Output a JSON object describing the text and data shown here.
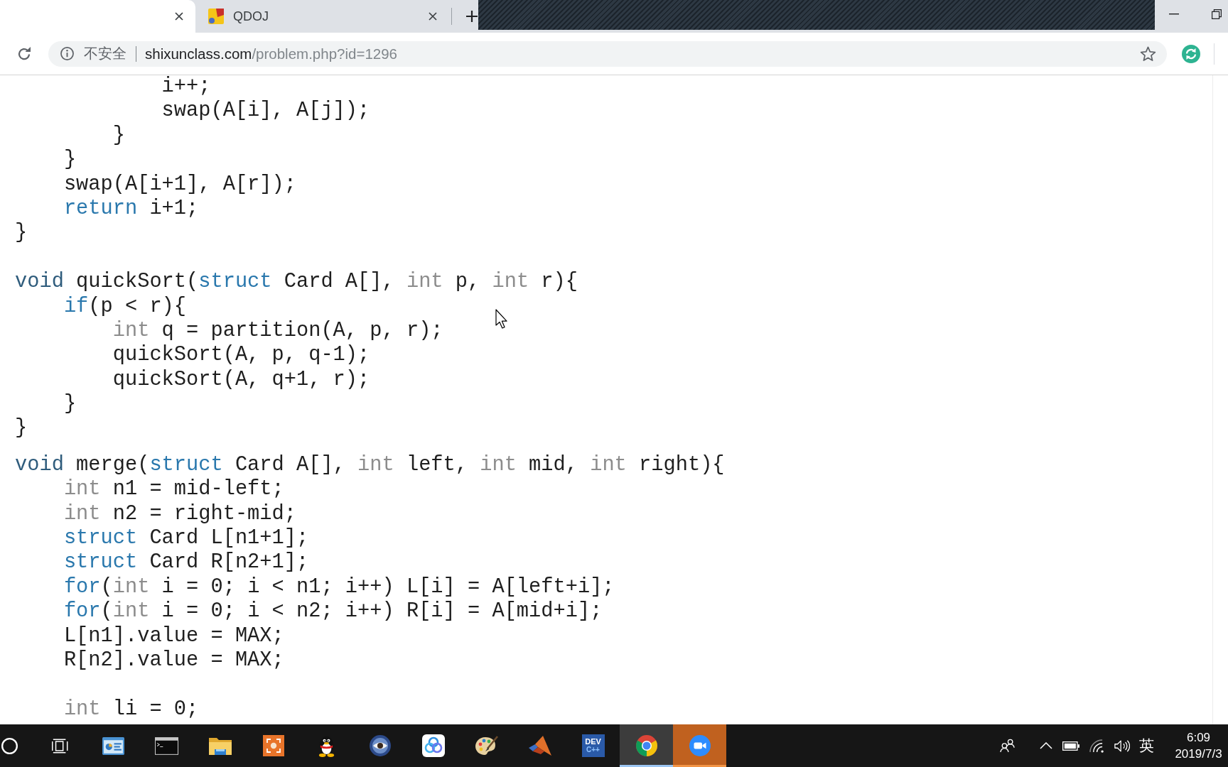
{
  "browser": {
    "tabs": [
      {
        "selected": true
      },
      {
        "title": "QDOJ",
        "selected": false
      }
    ],
    "toolbar": {
      "security_label": "不安全",
      "url_host": "shixunclass.com",
      "url_path": "/problem.php?id=1296"
    }
  },
  "page": {
    "code_blocks": [
      {
        "lines": [
          {
            "kind": "code",
            "tokens": [
              {
                "kind": "plain",
                "text": "            i++;"
              }
            ]
          },
          {
            "kind": "code",
            "tokens": [
              {
                "kind": "plain",
                "text": "            swap(A[i], A[j]);"
              }
            ]
          },
          {
            "kind": "code",
            "tokens": [
              {
                "kind": "plain",
                "text": "        }"
              }
            ]
          },
          {
            "kind": "code",
            "tokens": [
              {
                "kind": "plain",
                "text": "    }"
              }
            ]
          },
          {
            "kind": "code",
            "tokens": [
              {
                "kind": "plain",
                "text": "    swap(A[i+1], A[r]);"
              }
            ]
          },
          {
            "kind": "code",
            "tokens": [
              {
                "kind": "keyword",
                "text": "    return"
              },
              {
                "kind": "plain",
                "text": " i+1;"
              }
            ]
          },
          {
            "kind": "code",
            "tokens": [
              {
                "kind": "plain",
                "text": "}"
              }
            ]
          },
          {
            "kind": "blank"
          },
          {
            "kind": "code",
            "tokens": [
              {
                "kind": "keyword_dark",
                "text": "void"
              },
              {
                "kind": "plain",
                "text": " quickSort("
              },
              {
                "kind": "keyword",
                "text": "struct"
              },
              {
                "kind": "plain",
                "text": " Card A[], "
              },
              {
                "kind": "type",
                "text": "int"
              },
              {
                "kind": "plain",
                "text": " p, "
              },
              {
                "kind": "type",
                "text": "int"
              },
              {
                "kind": "plain",
                "text": " r){"
              }
            ]
          },
          {
            "kind": "code",
            "tokens": [
              {
                "kind": "keyword",
                "text": "    if"
              },
              {
                "kind": "plain",
                "text": "(p < r){"
              }
            ]
          },
          {
            "kind": "code",
            "tokens": [
              {
                "kind": "type",
                "text": "        int"
              },
              {
                "kind": "plain",
                "text": " q = partition(A, p, r);"
              }
            ]
          },
          {
            "kind": "code",
            "tokens": [
              {
                "kind": "plain",
                "text": "        quickSort(A, p, q-1);"
              }
            ]
          },
          {
            "kind": "code",
            "tokens": [
              {
                "kind": "plain",
                "text": "        quickSort(A, q+1, r);"
              }
            ]
          },
          {
            "kind": "code",
            "tokens": [
              {
                "kind": "plain",
                "text": "    }"
              }
            ]
          },
          {
            "kind": "code",
            "tokens": [
              {
                "kind": "plain",
                "text": "}"
              }
            ]
          }
        ]
      },
      {
        "lines": [
          {
            "kind": "code",
            "tokens": [
              {
                "kind": "keyword_dark",
                "text": "void"
              },
              {
                "kind": "plain",
                "text": " merge("
              },
              {
                "kind": "keyword",
                "text": "struct"
              },
              {
                "kind": "plain",
                "text": " Card A[], "
              },
              {
                "kind": "type",
                "text": "int"
              },
              {
                "kind": "plain",
                "text": " left, "
              },
              {
                "kind": "type",
                "text": "int"
              },
              {
                "kind": "plain",
                "text": " mid, "
              },
              {
                "kind": "type",
                "text": "int"
              },
              {
                "kind": "plain",
                "text": " right){"
              }
            ]
          },
          {
            "kind": "code",
            "tokens": [
              {
                "kind": "type",
                "text": "    int"
              },
              {
                "kind": "plain",
                "text": " n1 = mid-left;"
              }
            ]
          },
          {
            "kind": "code",
            "tokens": [
              {
                "kind": "type",
                "text": "    int"
              },
              {
                "kind": "plain",
                "text": " n2 = right-mid;"
              }
            ]
          },
          {
            "kind": "code",
            "tokens": [
              {
                "kind": "keyword",
                "text": "    struct"
              },
              {
                "kind": "plain",
                "text": " Card L[n1+1];"
              }
            ]
          },
          {
            "kind": "code",
            "tokens": [
              {
                "kind": "keyword",
                "text": "    struct"
              },
              {
                "kind": "plain",
                "text": " Card R[n2+1];"
              }
            ]
          },
          {
            "kind": "code",
            "tokens": [
              {
                "kind": "keyword",
                "text": "    for"
              },
              {
                "kind": "plain",
                "text": "("
              },
              {
                "kind": "type",
                "text": "int"
              },
              {
                "kind": "plain",
                "text": " i = 0; i < n1; i++) L[i] = A[left+i];"
              }
            ]
          },
          {
            "kind": "code",
            "tokens": [
              {
                "kind": "keyword",
                "text": "    for"
              },
              {
                "kind": "plain",
                "text": "("
              },
              {
                "kind": "type",
                "text": "int"
              },
              {
                "kind": "plain",
                "text": " i = 0; i < n2; i++) R[i] = A[mid+i];"
              }
            ]
          },
          {
            "kind": "code",
            "tokens": [
              {
                "kind": "plain",
                "text": "    L[n1].value = MAX;"
              }
            ]
          },
          {
            "kind": "code",
            "tokens": [
              {
                "kind": "plain",
                "text": "    R[n2].value = MAX;"
              }
            ]
          },
          {
            "kind": "blank"
          },
          {
            "kind": "code",
            "tokens": [
              {
                "kind": "type",
                "text": "    int"
              },
              {
                "kind": "plain",
                "text": " li = 0;"
              }
            ]
          }
        ]
      }
    ]
  },
  "taskbar": {
    "apps": [
      {
        "kind": "window_chart",
        "selected": false,
        "attention": false
      },
      {
        "kind": "terminal",
        "selected": false,
        "attention": false
      },
      {
        "kind": "folder",
        "selected": false,
        "attention": false
      },
      {
        "kind": "focus_tile",
        "selected": false,
        "attention": false
      },
      {
        "kind": "penguin",
        "selected": false,
        "attention": false
      },
      {
        "kind": "eye_disc",
        "selected": false,
        "attention": false
      },
      {
        "kind": "rings_tile",
        "selected": false,
        "attention": false
      },
      {
        "kind": "palette",
        "selected": false,
        "attention": false
      },
      {
        "kind": "peak",
        "selected": false,
        "attention": false
      },
      {
        "kind": "dev_tile",
        "label": "DEV",
        "sublabel": "C++",
        "selected": false,
        "attention": false
      },
      {
        "kind": "segment_disc",
        "selected": true,
        "attention": false
      },
      {
        "kind": "video_disc",
        "selected": false,
        "attention": true
      }
    ],
    "tray": {
      "input_method": "英",
      "time": "6:09",
      "date": "2019/7/3"
    }
  }
}
